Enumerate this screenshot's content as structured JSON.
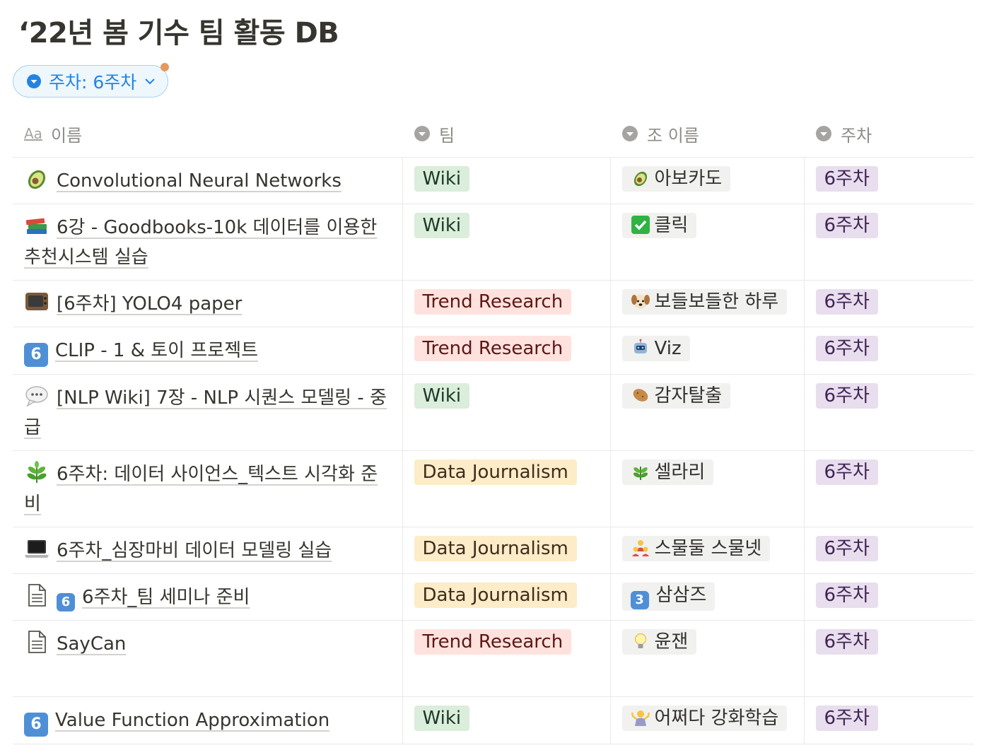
{
  "page": {
    "title": "‘22년 봄 기수 팀 활동 DB"
  },
  "filter": {
    "label": "주차: 6주차"
  },
  "columns": {
    "name": "이름",
    "name_icon": "Aa",
    "team": "팀",
    "group": "조 이름",
    "week": "주차"
  },
  "rows": [
    {
      "icon": "avocado-icon",
      "name": "Convolutional Neural Networks",
      "team": "Wiki",
      "team_color": "green",
      "group_icon": "avocado-icon",
      "group": "아보카도",
      "week": "6주차"
    },
    {
      "icon": "books-icon",
      "name": "6강 - Goodbooks-10k 데이터를 이용한 추천시스템 실습",
      "team": "Wiki",
      "team_color": "green",
      "group_icon": "check-icon",
      "group": "클릭",
      "week": "6주차"
    },
    {
      "icon": "tv-icon",
      "name": "[6주차] YOLO4 paper",
      "team": "Trend Research",
      "team_color": "red",
      "group_icon": "dog-icon",
      "group": "보들보들한 하루",
      "week": "6주차"
    },
    {
      "icon": "keycap-6-icon",
      "icon_text": "6",
      "name": "CLIP - 1 & 토이 프로젝트",
      "team": "Trend Research",
      "team_color": "red",
      "group_icon": "robot-icon",
      "group": "Viz",
      "week": "6주차"
    },
    {
      "icon": "speech-bubble-icon",
      "name": "[NLP Wiki] 7장 - NLP 시퀀스 모델링 - 중급",
      "team": "Wiki",
      "team_color": "green",
      "group_icon": "potato-icon",
      "group": "감자탈출",
      "week": "6주차"
    },
    {
      "icon": "herb-icon",
      "name": "6주차: 데이터 사이언스_텍스트 시각화 준비",
      "team": "Data Journalism",
      "team_color": "yellow",
      "group_icon": "herb-icon",
      "group": "셀라리",
      "week": "6주차"
    },
    {
      "icon": "laptop-icon",
      "name": "6주차_심장마비 데이터 모델링 실습",
      "team": "Data Journalism",
      "team_color": "yellow",
      "group_icon": "people-icon",
      "group": "스물둘 스물넷",
      "week": "6주차"
    },
    {
      "icon": "page-icon",
      "prefix_icon_text": "6",
      "name": "6주차_팀 세미나 준비",
      "team": "Data Journalism",
      "team_color": "yellow",
      "group_icon": "keycap-3-icon",
      "group_icon_text": "3",
      "group": "삼삼즈",
      "week": "6주차"
    },
    {
      "icon": "page-icon",
      "name": "SayCan",
      "team": "Trend Research",
      "team_color": "red",
      "group_icon": "bulb-icon",
      "group": "윤잰",
      "week": "6주차"
    },
    {
      "icon": "keycap-6-icon",
      "icon_text": "6",
      "name": "Value Function Approximation",
      "team": "Wiki",
      "team_color": "green",
      "group_icon": "shrug-icon",
      "group": "어쩌다 강화학습",
      "week": "6주차"
    }
  ],
  "colors": {
    "filter_blue": "#2383e2",
    "border": "#e9e9e7",
    "text": "#37352f",
    "header_text": "#8e8c88"
  }
}
